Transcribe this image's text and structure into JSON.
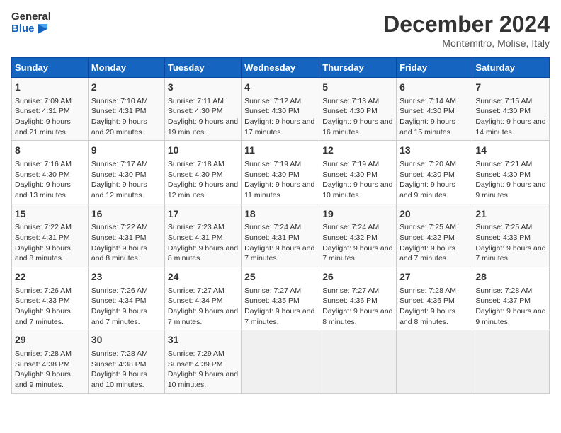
{
  "header": {
    "logo_line1": "General",
    "logo_line2": "Blue",
    "month_title": "December 2024",
    "subtitle": "Montemitro, Molise, Italy"
  },
  "days_of_week": [
    "Sunday",
    "Monday",
    "Tuesday",
    "Wednesday",
    "Thursday",
    "Friday",
    "Saturday"
  ],
  "weeks": [
    [
      {
        "day": "1",
        "info": "Sunrise: 7:09 AM\nSunset: 4:31 PM\nDaylight: 9 hours and 21 minutes."
      },
      {
        "day": "2",
        "info": "Sunrise: 7:10 AM\nSunset: 4:31 PM\nDaylight: 9 hours and 20 minutes."
      },
      {
        "day": "3",
        "info": "Sunrise: 7:11 AM\nSunset: 4:30 PM\nDaylight: 9 hours and 19 minutes."
      },
      {
        "day": "4",
        "info": "Sunrise: 7:12 AM\nSunset: 4:30 PM\nDaylight: 9 hours and 17 minutes."
      },
      {
        "day": "5",
        "info": "Sunrise: 7:13 AM\nSunset: 4:30 PM\nDaylight: 9 hours and 16 minutes."
      },
      {
        "day": "6",
        "info": "Sunrise: 7:14 AM\nSunset: 4:30 PM\nDaylight: 9 hours and 15 minutes."
      },
      {
        "day": "7",
        "info": "Sunrise: 7:15 AM\nSunset: 4:30 PM\nDaylight: 9 hours and 14 minutes."
      }
    ],
    [
      {
        "day": "8",
        "info": "Sunrise: 7:16 AM\nSunset: 4:30 PM\nDaylight: 9 hours and 13 minutes."
      },
      {
        "day": "9",
        "info": "Sunrise: 7:17 AM\nSunset: 4:30 PM\nDaylight: 9 hours and 12 minutes."
      },
      {
        "day": "10",
        "info": "Sunrise: 7:18 AM\nSunset: 4:30 PM\nDaylight: 9 hours and 12 minutes."
      },
      {
        "day": "11",
        "info": "Sunrise: 7:19 AM\nSunset: 4:30 PM\nDaylight: 9 hours and 11 minutes."
      },
      {
        "day": "12",
        "info": "Sunrise: 7:19 AM\nSunset: 4:30 PM\nDaylight: 9 hours and 10 minutes."
      },
      {
        "day": "13",
        "info": "Sunrise: 7:20 AM\nSunset: 4:30 PM\nDaylight: 9 hours and 9 minutes."
      },
      {
        "day": "14",
        "info": "Sunrise: 7:21 AM\nSunset: 4:30 PM\nDaylight: 9 hours and 9 minutes."
      }
    ],
    [
      {
        "day": "15",
        "info": "Sunrise: 7:22 AM\nSunset: 4:31 PM\nDaylight: 9 hours and 8 minutes."
      },
      {
        "day": "16",
        "info": "Sunrise: 7:22 AM\nSunset: 4:31 PM\nDaylight: 9 hours and 8 minutes."
      },
      {
        "day": "17",
        "info": "Sunrise: 7:23 AM\nSunset: 4:31 PM\nDaylight: 9 hours and 8 minutes."
      },
      {
        "day": "18",
        "info": "Sunrise: 7:24 AM\nSunset: 4:31 PM\nDaylight: 9 hours and 7 minutes."
      },
      {
        "day": "19",
        "info": "Sunrise: 7:24 AM\nSunset: 4:32 PM\nDaylight: 9 hours and 7 minutes."
      },
      {
        "day": "20",
        "info": "Sunrise: 7:25 AM\nSunset: 4:32 PM\nDaylight: 9 hours and 7 minutes."
      },
      {
        "day": "21",
        "info": "Sunrise: 7:25 AM\nSunset: 4:33 PM\nDaylight: 9 hours and 7 minutes."
      }
    ],
    [
      {
        "day": "22",
        "info": "Sunrise: 7:26 AM\nSunset: 4:33 PM\nDaylight: 9 hours and 7 minutes."
      },
      {
        "day": "23",
        "info": "Sunrise: 7:26 AM\nSunset: 4:34 PM\nDaylight: 9 hours and 7 minutes."
      },
      {
        "day": "24",
        "info": "Sunrise: 7:27 AM\nSunset: 4:34 PM\nDaylight: 9 hours and 7 minutes."
      },
      {
        "day": "25",
        "info": "Sunrise: 7:27 AM\nSunset: 4:35 PM\nDaylight: 9 hours and 7 minutes."
      },
      {
        "day": "26",
        "info": "Sunrise: 7:27 AM\nSunset: 4:36 PM\nDaylight: 9 hours and 8 minutes."
      },
      {
        "day": "27",
        "info": "Sunrise: 7:28 AM\nSunset: 4:36 PM\nDaylight: 9 hours and 8 minutes."
      },
      {
        "day": "28",
        "info": "Sunrise: 7:28 AM\nSunset: 4:37 PM\nDaylight: 9 hours and 9 minutes."
      }
    ],
    [
      {
        "day": "29",
        "info": "Sunrise: 7:28 AM\nSunset: 4:38 PM\nDaylight: 9 hours and 9 minutes."
      },
      {
        "day": "30",
        "info": "Sunrise: 7:28 AM\nSunset: 4:38 PM\nDaylight: 9 hours and 10 minutes."
      },
      {
        "day": "31",
        "info": "Sunrise: 7:29 AM\nSunset: 4:39 PM\nDaylight: 9 hours and 10 minutes."
      },
      null,
      null,
      null,
      null
    ]
  ]
}
